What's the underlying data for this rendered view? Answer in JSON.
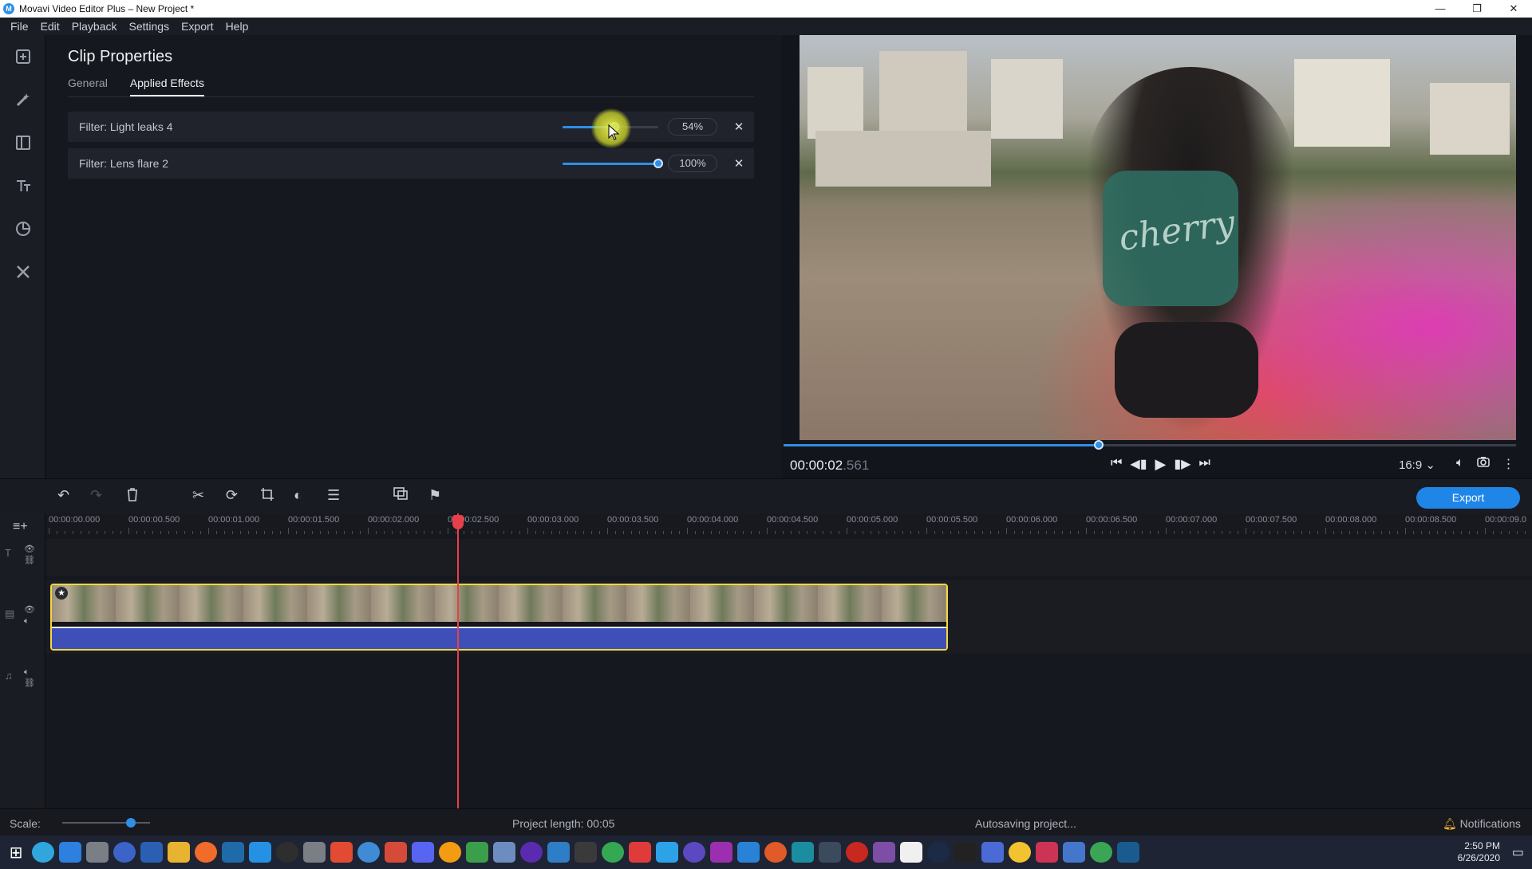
{
  "window": {
    "title": "Movavi Video Editor Plus – New Project *",
    "controls": [
      "—",
      "❐",
      "✕"
    ]
  },
  "menu": [
    "File",
    "Edit",
    "Playback",
    "Settings",
    "Export",
    "Help"
  ],
  "rail_icons": [
    "import-icon",
    "magic-wand-icon",
    "transitions-icon",
    "titles-icon",
    "stickers-icon",
    "more-tools-icon"
  ],
  "properties": {
    "title": "Clip Properties",
    "tabs": [
      {
        "label": "General",
        "active": false
      },
      {
        "label": "Applied Effects",
        "active": true
      }
    ],
    "effects": [
      {
        "name": "Filter: Light leaks 4",
        "value_label": "54%",
        "value": 54
      },
      {
        "name": "Filter: Lens flare 2",
        "value_label": "100%",
        "value": 100
      }
    ]
  },
  "preview": {
    "shirt_text": "cherry",
    "scrub_fraction": 0.43,
    "timecode_main": "00:00:02",
    "timecode_ms": ".561",
    "aspect_ratio": "16:9 ⌄"
  },
  "toolbar": {
    "export_label": "Export"
  },
  "timeline": {
    "ruler_labels": [
      "00:00:00.000",
      "00:00:00.500",
      "00:00:01.000",
      "00:00:01.500",
      "00:00:02.000",
      "00:00:02.500",
      "00:00:03.000",
      "00:00:03.500",
      "00:00:04.000",
      "00:00:04.500",
      "00:00:05.000",
      "00:00:05.500",
      "00:00:06.000",
      "00:00:06.500",
      "00:00:07.000",
      "00:00:07.500",
      "00:00:08.000",
      "00:00:08.500",
      "00:00:09.0"
    ]
  },
  "status": {
    "scale_label": "Scale:",
    "project_length": "Project length: 00:05",
    "autosave": "Autosaving project...",
    "notifications": "Notifications"
  },
  "taskbar": {
    "time": "2:50 PM",
    "date": "6/26/2020",
    "icon_colors": [
      "#2fa6de",
      "#2d7fe0",
      "#7a7f86",
      "#3c63c7",
      "#2b5fb3",
      "#e8b330",
      "#f16b2a",
      "#1f6aa8",
      "#2591e5",
      "#2e2e2e",
      "#7a7f86",
      "#e24a33",
      "#3f8bd6",
      "#d64a3a",
      "#5865f2",
      "#f39c12",
      "#3a9e4a",
      "#6d8cc0",
      "#5a2bb0",
      "#2e7ec7",
      "#3a3a3a",
      "#34a853",
      "#e03b3b",
      "#2ca3e8",
      "#5b49c2",
      "#9b2fb0",
      "#2a82d6",
      "#e05a2a",
      "#1a8ea0",
      "#3b4a5c",
      "#c8281f",
      "#7c4ea6",
      "#f0f0f0",
      "#1b2a45",
      "#222222",
      "#4a6bd6",
      "#f3c230",
      "#cc3355",
      "#4477cc",
      "#3aa655",
      "#1a5b8f"
    ]
  }
}
